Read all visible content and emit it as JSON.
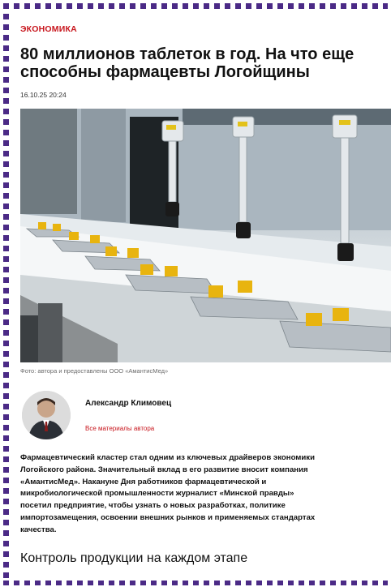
{
  "article": {
    "category": "ЭКОНОМИКА",
    "headline": "80 миллионов таблеток в год. На что еще способны фармацевты Логойщины",
    "date": "16.10.25 20:24",
    "photo_caption": "Фото: автора и предоставлены ООО «АмантисМед»",
    "author": {
      "name": "Александр Климовец",
      "link_label": "Все материалы автора"
    },
    "lead": "Фармацевтический кластер стал одним из ключевых драйверов экономики\nЛогойского района. Значительный вклад в его развитие вносит компания\n«АмантисМед». Накануне Дня работников фармацевтической и\nмикробиологической промышленности журналист «Минской правды»\nпосетил предприятие, чтобы узнать о новых разработках, политике\nимпортозамещения, освоении внешних рынков и применяемых стандартах\nкачества.",
    "subheading": "Контроль продукции на каждом этапе"
  },
  "colors": {
    "accent_red": "#c8161d",
    "frame_purple": "#4b2a86"
  }
}
